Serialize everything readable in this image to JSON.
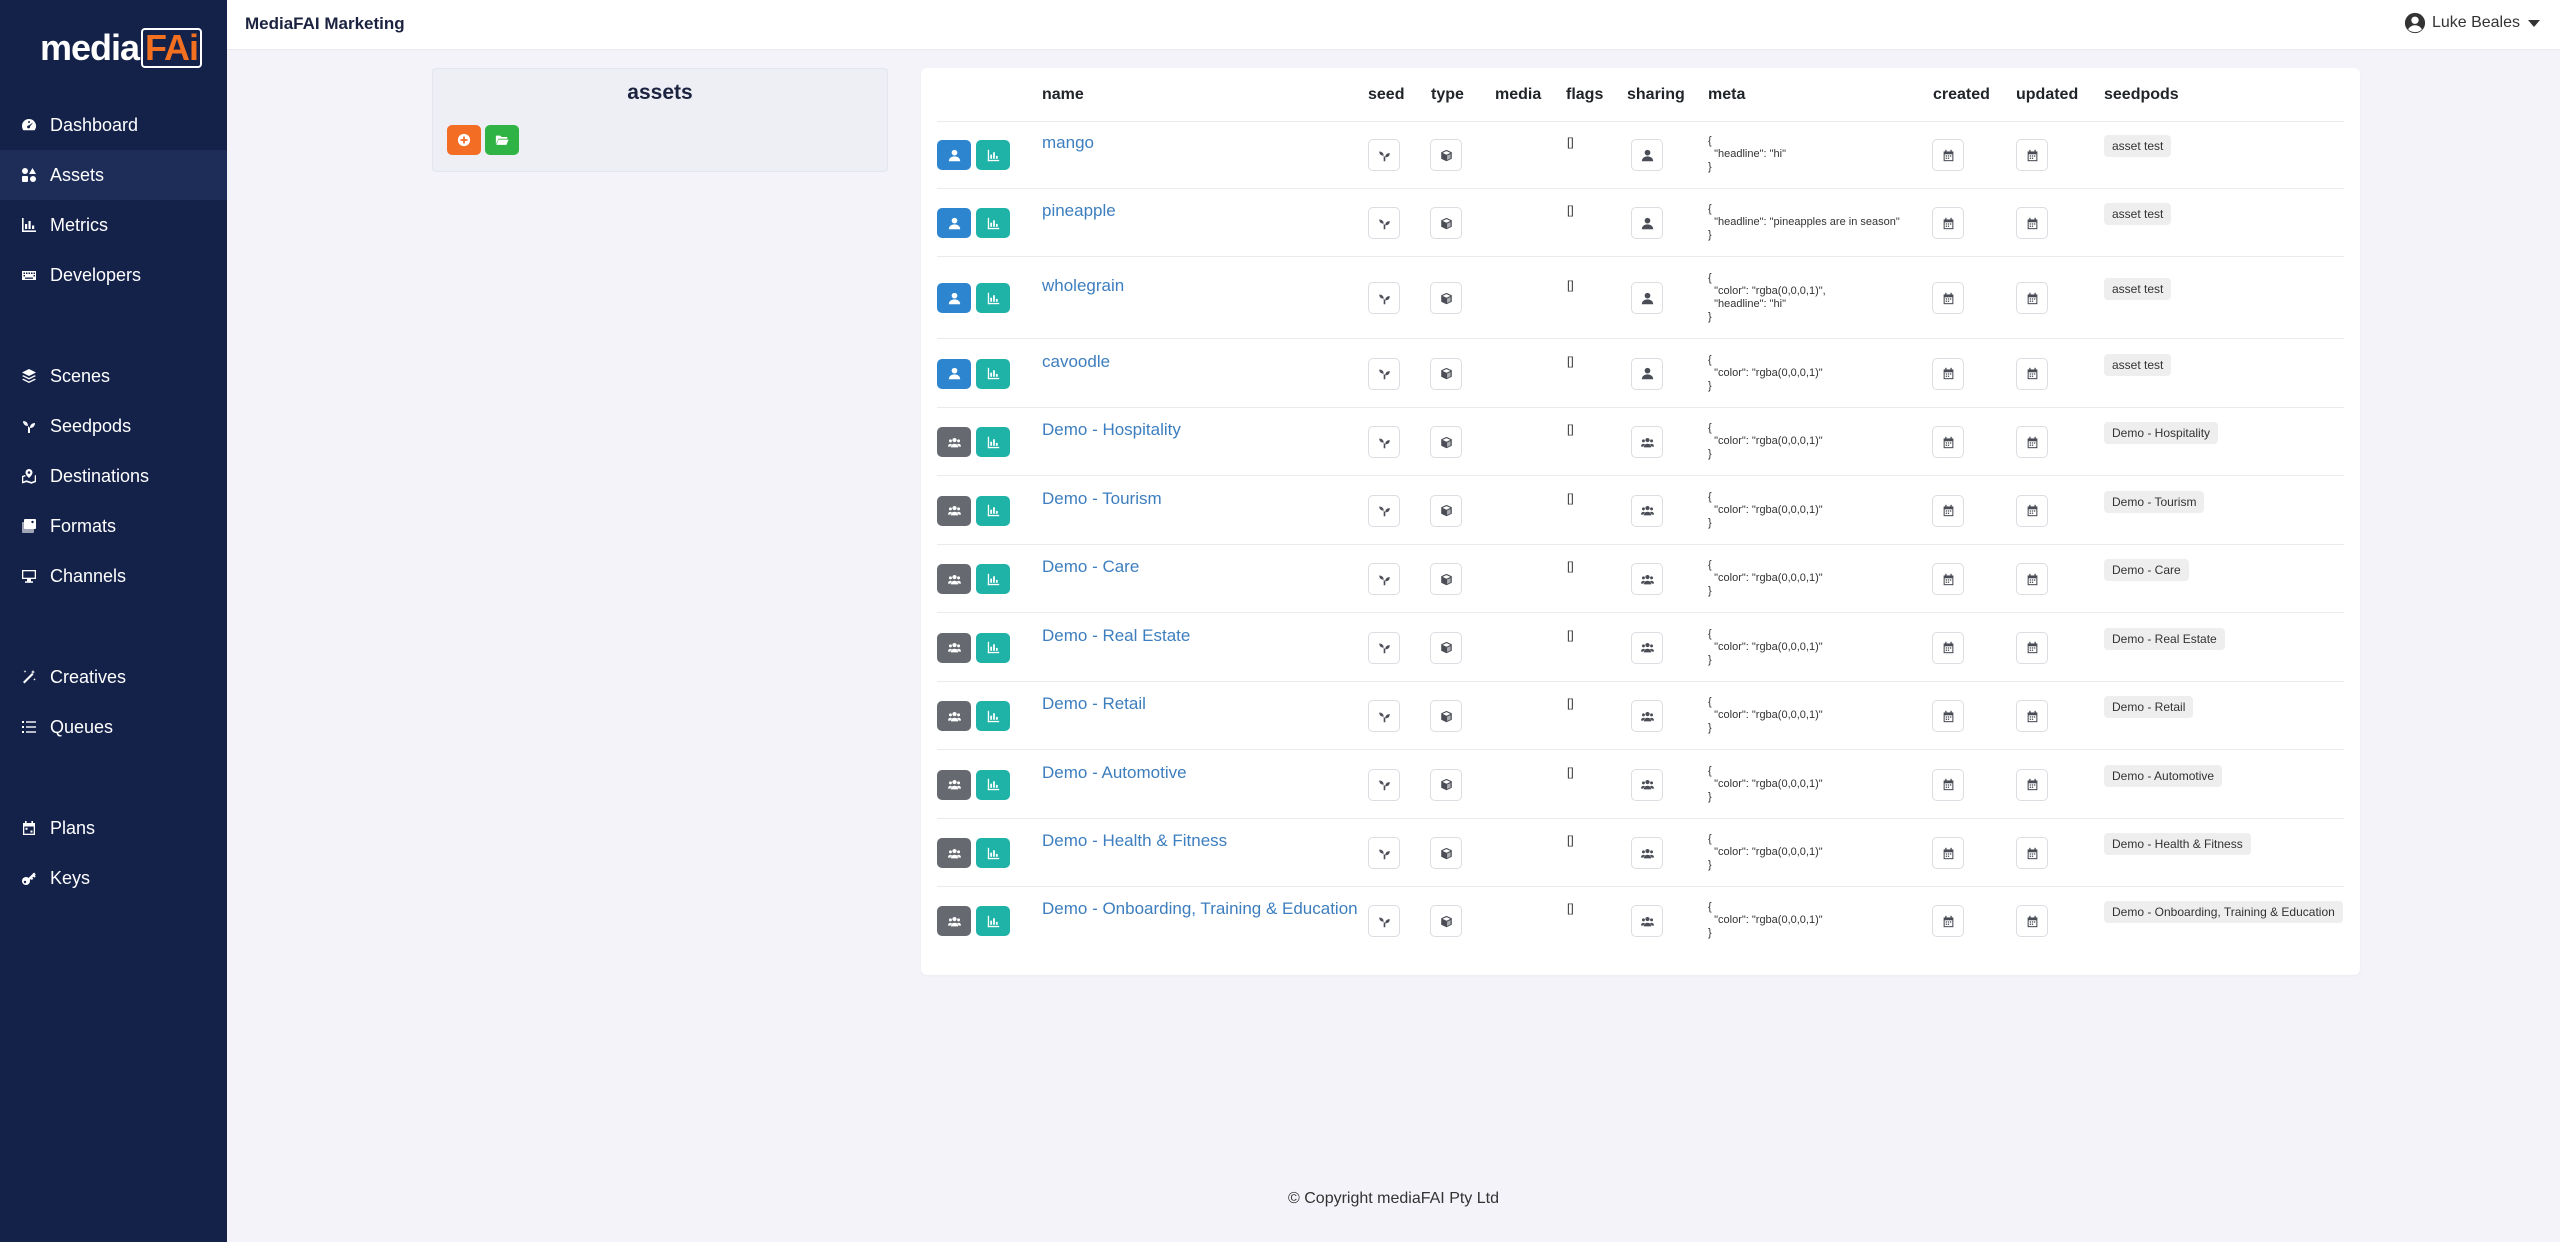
{
  "brand": {
    "logo_left": "media",
    "logo_right": "FAi"
  },
  "header": {
    "org_title": "MediaFAI Marketing",
    "user_name": "Luke Beales"
  },
  "sidebar": {
    "items": [
      {
        "label": "Dashboard",
        "icon": "tachometer-icon"
      },
      {
        "label": "Assets",
        "icon": "shapes-icon",
        "active": true
      },
      {
        "label": "Metrics",
        "icon": "chart-bar-icon"
      },
      {
        "label": "Developers",
        "icon": "keyboard-icon"
      },
      {
        "label": "Scenes",
        "icon": "layer-group-icon"
      },
      {
        "label": "Seedpods",
        "icon": "seedling-icon"
      },
      {
        "label": "Destinations",
        "icon": "map-marked-icon"
      },
      {
        "label": "Formats",
        "icon": "images-icon"
      },
      {
        "label": "Channels",
        "icon": "desktop-icon"
      },
      {
        "label": "Creatives",
        "icon": "magic-icon"
      },
      {
        "label": "Queues",
        "icon": "list-icon"
      },
      {
        "label": "Plans",
        "icon": "calendar-icon"
      },
      {
        "label": "Keys",
        "icon": "key-icon"
      }
    ]
  },
  "assets_panel": {
    "title": "assets"
  },
  "table": {
    "columns": [
      "name",
      "seed",
      "type",
      "media",
      "flags",
      "sharing",
      "meta",
      "created",
      "updated",
      "seedpods"
    ],
    "rows": [
      {
        "name": "mango",
        "owner": "user",
        "flags": "[]",
        "sharing": "user",
        "meta": "{\n  \"headline\": \"hi\"\n}",
        "seedpod": "asset test"
      },
      {
        "name": "pineapple",
        "owner": "user",
        "flags": "[]",
        "sharing": "user",
        "meta": "{\n  \"headline\": \"pineapples are in season\"\n}",
        "seedpod": "asset test"
      },
      {
        "name": "wholegrain",
        "owner": "user",
        "flags": "[]",
        "sharing": "user",
        "meta": "{\n  \"color\": \"rgba(0,0,0,1)\",\n  \"headline\": \"hi\"\n}",
        "seedpod": "asset test"
      },
      {
        "name": "cavoodle",
        "owner": "user",
        "flags": "[]",
        "sharing": "user",
        "meta": "{\n  \"color\": \"rgba(0,0,0,1)\"\n}",
        "seedpod": "asset test"
      },
      {
        "name": "Demo - Hospitality",
        "owner": "group",
        "flags": "[]",
        "sharing": "group",
        "meta": "{\n  \"color\": \"rgba(0,0,0,1)\"\n}",
        "seedpod": "Demo - Hospitality"
      },
      {
        "name": "Demo - Tourism",
        "owner": "group",
        "flags": "[]",
        "sharing": "group",
        "meta": "{\n  \"color\": \"rgba(0,0,0,1)\"\n}",
        "seedpod": "Demo - Tourism"
      },
      {
        "name": "Demo - Care",
        "owner": "group",
        "flags": "[]",
        "sharing": "group",
        "meta": "{\n  \"color\": \"rgba(0,0,0,1)\"\n}",
        "seedpod": "Demo - Care"
      },
      {
        "name": "Demo - Real Estate",
        "owner": "group",
        "flags": "[]",
        "sharing": "group",
        "meta": "{\n  \"color\": \"rgba(0,0,0,1)\"\n}",
        "seedpod": "Demo - Real Estate"
      },
      {
        "name": "Demo - Retail",
        "owner": "group",
        "flags": "[]",
        "sharing": "group",
        "meta": "{\n  \"color\": \"rgba(0,0,0,1)\"\n}",
        "seedpod": "Demo - Retail"
      },
      {
        "name": "Demo - Automotive",
        "owner": "group",
        "flags": "[]",
        "sharing": "group",
        "meta": "{\n  \"color\": \"rgba(0,0,0,1)\"\n}",
        "seedpod": "Demo - Automotive"
      },
      {
        "name": "Demo - Health & Fitness",
        "owner": "group",
        "flags": "[]",
        "sharing": "group",
        "meta": "{\n  \"color\": \"rgba(0,0,0,1)\"\n}",
        "seedpod": "Demo - Health & Fitness"
      },
      {
        "name": "Demo - Onboarding, Training & Education",
        "owner": "group",
        "flags": "[]",
        "sharing": "group",
        "meta": "{\n  \"color\": \"rgba(0,0,0,1)\"\n}",
        "seedpod": "Demo - Onboarding, Training & Education"
      }
    ]
  },
  "footer": {
    "copyright": "© Copyright mediaFAI Pty Ltd"
  },
  "colors": {
    "sidebar_bg": "#14224a",
    "owner_user": "#2d85d0",
    "owner_group": "#666a70",
    "metrics": "#1fb2a7",
    "add_button": "#f46d25",
    "folder_button": "#2fb344",
    "link": "#3d7ebf"
  }
}
